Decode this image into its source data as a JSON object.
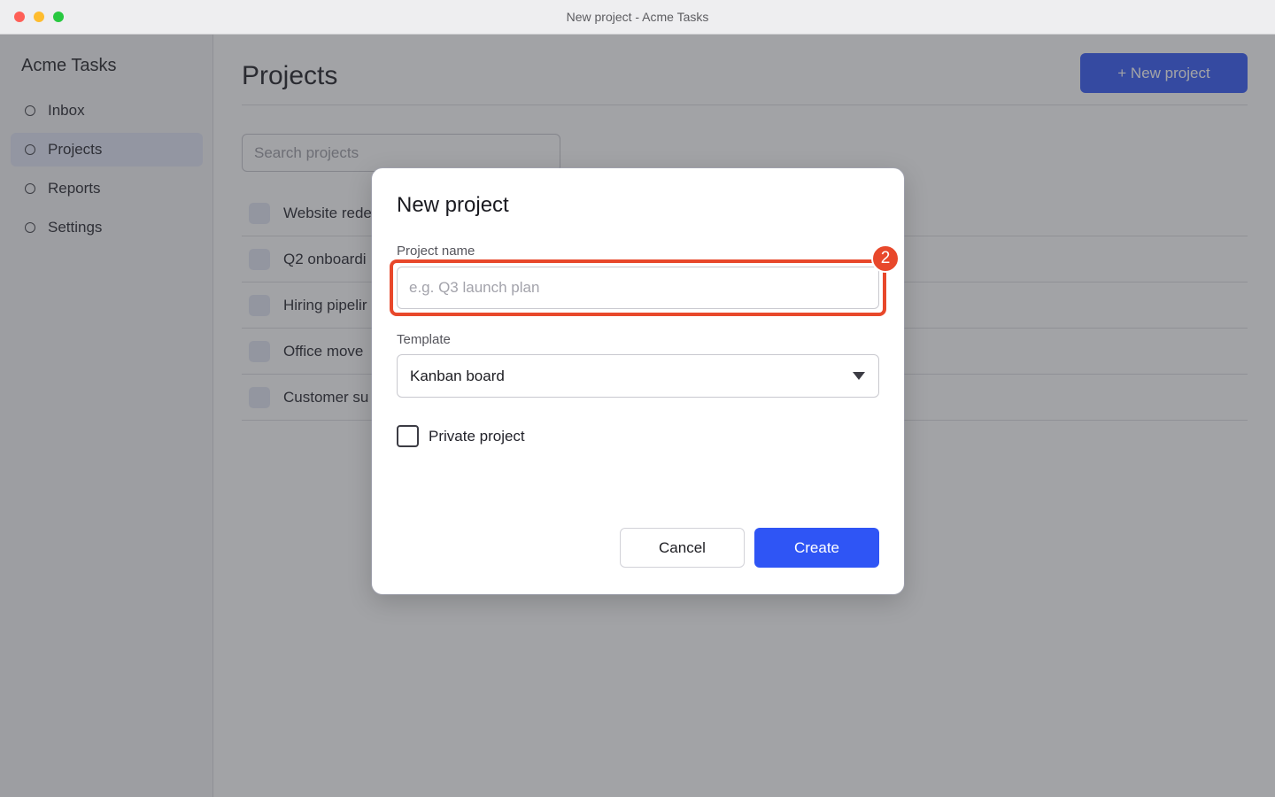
{
  "window": {
    "title": "New project - Acme Tasks"
  },
  "sidebar": {
    "app_name": "Acme Tasks",
    "items": [
      {
        "label": "Inbox",
        "active": false
      },
      {
        "label": "Projects",
        "active": true
      },
      {
        "label": "Reports",
        "active": false
      },
      {
        "label": "Settings",
        "active": false
      }
    ]
  },
  "main": {
    "title": "Projects",
    "new_project_button": "+ New project",
    "search_placeholder": "Search projects",
    "rows": [
      {
        "name": "Website rede"
      },
      {
        "name": "Q2 onboardi"
      },
      {
        "name": "Hiring pipelir"
      },
      {
        "name": "Office move"
      },
      {
        "name": "Customer su"
      }
    ]
  },
  "modal": {
    "title": "New project",
    "name_label": "Project name",
    "name_value": "",
    "name_placeholder": "e.g. Q3 launch plan",
    "template_label": "Template",
    "template_value": "Kanban board",
    "private_label": "Private project",
    "private_checked": false,
    "cancel_label": "Cancel",
    "create_label": "Create"
  },
  "annotation": {
    "step_number": "2",
    "color": "#e8482b"
  },
  "colors": {
    "accent": "#2f55f5"
  }
}
